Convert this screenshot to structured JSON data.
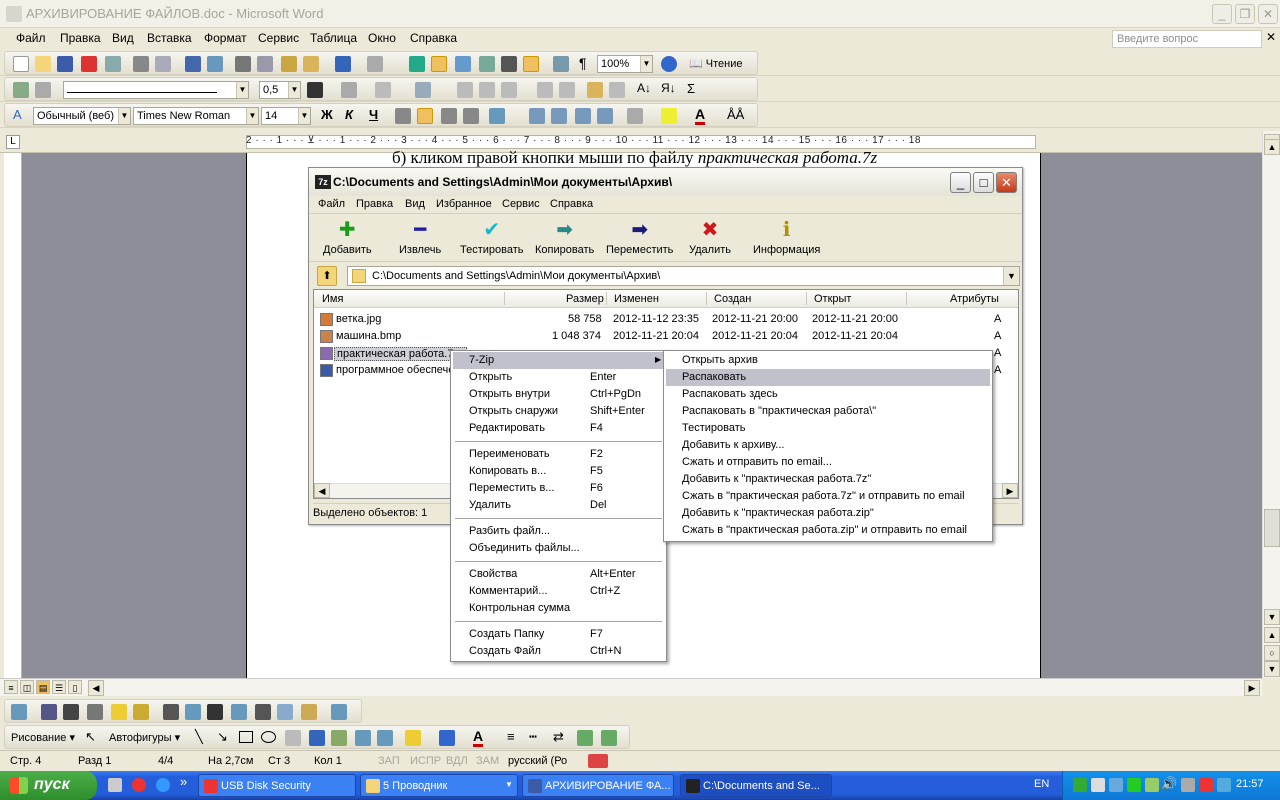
{
  "word": {
    "title": "АРХИВИРОВАНИЕ ФАЙЛОВ.doc - Microsoft Word",
    "menu": [
      "Файл",
      "Правка",
      "Вид",
      "Вставка",
      "Формат",
      "Сервис",
      "Таблица",
      "Окно",
      "Справка"
    ],
    "help_placeholder": "Введите вопрос",
    "zoom": "100%",
    "reading_label": "Чтение",
    "line_weight": "0,5",
    "style": "Обычный (веб)",
    "font": "Times New Roman",
    "font_size": "14",
    "bold": "Ж",
    "italic": "К",
    "underline": "Ч",
    "ruler_numbers": "2 · · · 1 · · · ⊻ · · · 1 · · · 2 · · · 3 · · · 4 · · · 5 · · · 6 · · · 7 · · · 8 · · · 9 · · · 10 · · · 11 · · · 12 · · · 13 · · · 14 · · · 15 · · · 16 · · · 17 · · · 18",
    "doc_line_prefix": "б) кликом правой кнопки мыши по файлу ",
    "doc_line_italic": "практическая работа.7z",
    "draw_label": "Рисование",
    "autoshapes_label": "Автофигуры",
    "status": {
      "page": "Стр. 4",
      "section": "Разд 1",
      "pages": "4/4",
      "at": "На 2,7см",
      "line": "Ст 3",
      "col": "Кол 1",
      "rec": "ЗАП",
      "trk": "ИСПР",
      "ext": "ВДЛ",
      "ovr": "ЗАМ",
      "lang": "русский (Ро"
    }
  },
  "zip": {
    "title": "C:\\Documents and Settings\\Admin\\Мои документы\\Архив\\",
    "menu": [
      "Файл",
      "Правка",
      "Вид",
      "Избранное",
      "Сервис",
      "Справка"
    ],
    "toolbar": [
      "Добавить",
      "Извлечь",
      "Тестировать",
      "Копировать",
      "Переместить",
      "Удалить",
      "Информация"
    ],
    "address": "C:\\Documents and Settings\\Admin\\Мои документы\\Архив\\",
    "columns": [
      "Имя",
      "Размер",
      "Изменен",
      "Создан",
      "Открыт",
      "Атрибуты"
    ],
    "rows": [
      {
        "name": "ветка.jpg",
        "size": "58 758",
        "modified": "2012-11-12 23:35",
        "created": "2012-11-21 20:00",
        "opened": "2012-11-21 20:00",
        "attr": "A"
      },
      {
        "name": "машина.bmp",
        "size": "1 048 374",
        "modified": "2012-11-21 20:04",
        "created": "2012-11-21 20:04",
        "opened": "2012-11-21 20:04",
        "attr": "A"
      },
      {
        "name": "практическая работа.7z",
        "size": "",
        "modified": "",
        "created": "",
        "opened": "",
        "attr": "A"
      },
      {
        "name": "программное обеспече",
        "size": "",
        "modified": "",
        "created": "",
        "opened": "",
        "attr": "A"
      }
    ],
    "status": "Выделено объектов: 1"
  },
  "context_menu": {
    "items": [
      {
        "label": "7-Zip",
        "shortcut": ""
      },
      {
        "label": "Открыть",
        "shortcut": "Enter"
      },
      {
        "label": "Открыть внутри",
        "shortcut": "Ctrl+PgDn"
      },
      {
        "label": "Открыть снаружи",
        "shortcut": "Shift+Enter"
      },
      {
        "label": "Редактировать",
        "shortcut": "F4"
      },
      {
        "label": "Переименовать",
        "shortcut": "F2"
      },
      {
        "label": "Копировать в...",
        "shortcut": "F5"
      },
      {
        "label": "Переместить в...",
        "shortcut": "F6"
      },
      {
        "label": "Удалить",
        "shortcut": "Del"
      },
      {
        "label": "Разбить файл...",
        "shortcut": ""
      },
      {
        "label": "Объединить файлы...",
        "shortcut": ""
      },
      {
        "label": "Свойства",
        "shortcut": "Alt+Enter"
      },
      {
        "label": "Комментарий...",
        "shortcut": "Ctrl+Z"
      },
      {
        "label": "Контрольная сумма",
        "shortcut": ""
      },
      {
        "label": "Создать Папку",
        "shortcut": "F7"
      },
      {
        "label": "Создать Файл",
        "shortcut": "Ctrl+N"
      }
    ]
  },
  "submenu": {
    "items": [
      "Открыть архив",
      "Распаковать",
      "Распаковать здесь",
      "Распаковать в \"практическая работа\\\"",
      "Тестировать",
      "Добавить к архиву...",
      "Сжать и отправить по email...",
      "Добавить к \"практическая работа.7z\"",
      "Сжать в \"практическая работа.7z\" и отправить по email",
      "Добавить к \"практическая работа.zip\"",
      "Сжать в \"практическая работа.zip\" и отправить по email"
    ]
  },
  "taskbar": {
    "start": "пуск",
    "tasks": [
      "USB Disk Security",
      "5 Проводник",
      "АРХИВИРОВАНИЕ ФА...",
      "C:\\Documents and Se..."
    ],
    "lang": "EN",
    "clock": "21:57"
  }
}
